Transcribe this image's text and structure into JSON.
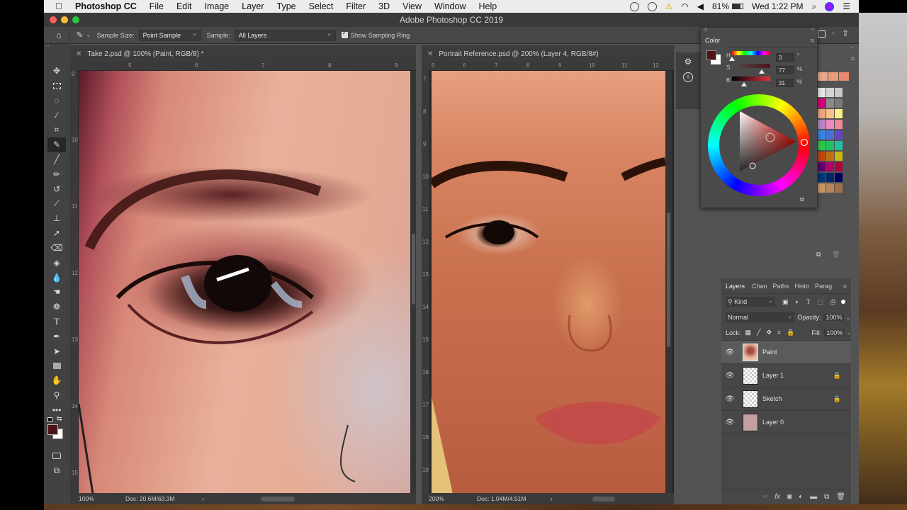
{
  "menubar": {
    "app_name": "Photoshop CC",
    "items": [
      "File",
      "Edit",
      "Image",
      "Layer",
      "Type",
      "Select",
      "Filter",
      "3D",
      "View",
      "Window",
      "Help"
    ],
    "battery": "81%",
    "clock": "Wed 1:22 PM"
  },
  "window": {
    "title": "Adobe Photoshop CC 2019"
  },
  "options_bar": {
    "sample_size_label": "Sample Size:",
    "sample_size_value": "Point Sample",
    "sample_label": "Sample:",
    "sample_value": "All Layers",
    "show_sampling_ring_label": "Show Sampling Ring",
    "show_sampling_ring_checked": true
  },
  "toolbar": {
    "tools": [
      "move",
      "marquee",
      "lasso",
      "magic-wand",
      "crop",
      "eyedropper",
      "brush",
      "pencil",
      "history-brush",
      "mixer-brush",
      "clone-stamp",
      "healing",
      "eraser",
      "paint-bucket",
      "blur",
      "smudge",
      "sponge",
      "type",
      "pen",
      "path-selection",
      "rectangle",
      "hand",
      "zoom",
      "more"
    ],
    "active_tool": "eyedropper",
    "foreground_color": "#4f1417",
    "background_color": "#ffffff"
  },
  "documents": [
    {
      "tab_title": "Take 2.psd @ 100% (Paint, RGB/8) *",
      "zoom": "100%",
      "doc_size": "Doc: 20.6M/63.3M",
      "ruler_h": [
        "5",
        "6",
        "7",
        "8",
        "9"
      ],
      "ruler_v": [
        "9",
        "10",
        "11",
        "12",
        "13",
        "14",
        "15"
      ]
    },
    {
      "tab_title": "Portrait Reference.psd @ 200% (Layer 4, RGB/8#)",
      "zoom": "200%",
      "doc_size": "Doc: 1.04M/4.51M",
      "ruler_h": [
        "5",
        "6",
        "7",
        "8",
        "9",
        "10",
        "11",
        "12"
      ],
      "ruler_v": [
        "7",
        "8",
        "9",
        "10",
        "11",
        "12",
        "13",
        "14",
        "15",
        "16",
        "17",
        "18",
        "19"
      ]
    }
  ],
  "color_panel": {
    "title": "Color",
    "h_label": "H",
    "h_value": "3",
    "h_unit": "°",
    "s_label": "S",
    "s_value": "77",
    "s_unit": "%",
    "b_label": "B",
    "b_value": "31",
    "b_unit": "%",
    "h_fraction": 0.008,
    "s_fraction": 0.77,
    "b_fraction": 0.31,
    "current_color": "#4f1417"
  },
  "swatches": {
    "recent": [
      "#e9a88a",
      "#e89c78",
      "#e58a6a"
    ],
    "grid": [
      [
        "#e8e8e8",
        "#d4d4d4",
        "#c8c8c8"
      ],
      [
        "#d4007a",
        "#8a8a8a",
        "#7a7a7a"
      ],
      [
        "#f0a880",
        "#f8c088",
        "#fff088"
      ],
      [
        "#b888c8",
        "#f088c0",
        "#f08898"
      ],
      [
        "#3888e0",
        "#4870d8",
        "#6048c0"
      ],
      [
        "#30c850",
        "#20c060",
        "#20c0a0"
      ],
      [
        "#c04810",
        "#c07010",
        "#c8b810"
      ],
      [
        "#600070",
        "#b0006a",
        "#b00040"
      ],
      [
        "#003878",
        "#002868",
        "#000060"
      ],
      [
        "#c8986a",
        "#b8845a",
        "#a0704a"
      ]
    ]
  },
  "layers_panel": {
    "tabs": [
      "Layers",
      "Chan",
      "Paths",
      "Histo",
      "Parag"
    ],
    "active_tab": "Layers",
    "filter_kind": "Kind",
    "blend_mode": "Normal",
    "opacity_label": "Opacity:",
    "opacity_value": "100%",
    "lock_label": "Lock:",
    "fill_label": "Fill:",
    "fill_value": "100%",
    "layers": [
      {
        "name": "Paint",
        "visible": true,
        "locked": false,
        "selected": true
      },
      {
        "name": "Layer 1",
        "visible": true,
        "locked": true,
        "selected": false
      },
      {
        "name": "Sketch",
        "visible": true,
        "locked": true,
        "selected": false
      },
      {
        "name": "Layer 0",
        "visible": true,
        "locked": false,
        "selected": false
      }
    ]
  }
}
